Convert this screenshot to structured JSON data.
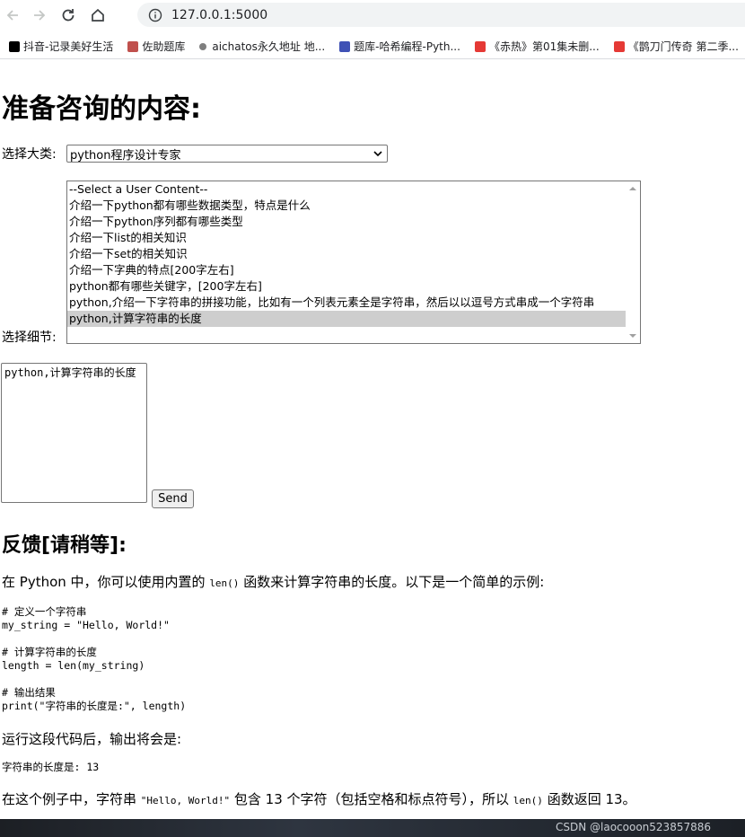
{
  "browser": {
    "url": "127.0.0.1:5000",
    "bookmarks": [
      {
        "label": "抖音-记录美好生活",
        "icon": "tiktok-icon",
        "color": "#000000"
      },
      {
        "label": "佐助题库",
        "icon": "ninja-icon",
        "color": "#c0504d"
      },
      {
        "label": "aichatos永久地址 地...",
        "icon": "globe-dot-icon",
        "color": "#7f7f7f"
      },
      {
        "label": "题库-哈希编程-Pyth...",
        "icon": "keyboard-icon",
        "color": "#3f51b5"
      },
      {
        "label": "《赤热》第01集未删...",
        "icon": "video-icon",
        "color": "#e53935"
      },
      {
        "label": "《鹊刀门传奇 第二季...",
        "icon": "video-icon",
        "color": "#e53935"
      }
    ]
  },
  "page": {
    "title": "准备咨询的内容:",
    "category": {
      "label": "选择大类:",
      "selected": "python程序设计专家"
    },
    "detail": {
      "label": "选择细节:",
      "options": [
        "--Select a User Content--",
        "介绍一下python都有哪些数据类型，特点是什么",
        "介绍一下python序列都有哪些类型",
        "介绍一下list的相关知识",
        "介绍一下set的相关知识",
        "介绍一下字典的特点[200字左右]",
        "python都有哪些关键字，[200字左右]",
        "python,介绍一下字符串的拼接功能，比如有一个列表元素全是字符串，然后以以逗号方式串成一个字符串",
        "python,计算字符串的长度"
      ],
      "selected_index": 8
    },
    "textarea_value": "python,计算字符串的长度",
    "send_label": "Send",
    "feedback_title": "反馈[请稍等]:",
    "answer": {
      "intro_before": "在 Python 中，你可以使用内置的 ",
      "intro_code": "len()",
      "intro_after": " 函数来计算字符串的长度。以下是一个简单的示例:",
      "code_block": "# 定义一个字符串\nmy_string = \"Hello, World!\"\n\n# 计算字符串的长度\nlength = len(my_string)\n\n# 输出结果\nprint(\"字符串的长度是:\", length)",
      "run_text": "运行这段代码后，输出将会是:",
      "output": "字符串的长度是: 13",
      "conclusion_before": "在这个例子中，字符串 ",
      "conclusion_code1": "\"Hello, World!\"",
      "conclusion_middle": " 包含 13 个字符（包括空格和标点符号），所以 ",
      "conclusion_code2": "len()",
      "conclusion_after": " 函数返回 13。"
    }
  },
  "watermark": "CSDN @laocooon523857886"
}
